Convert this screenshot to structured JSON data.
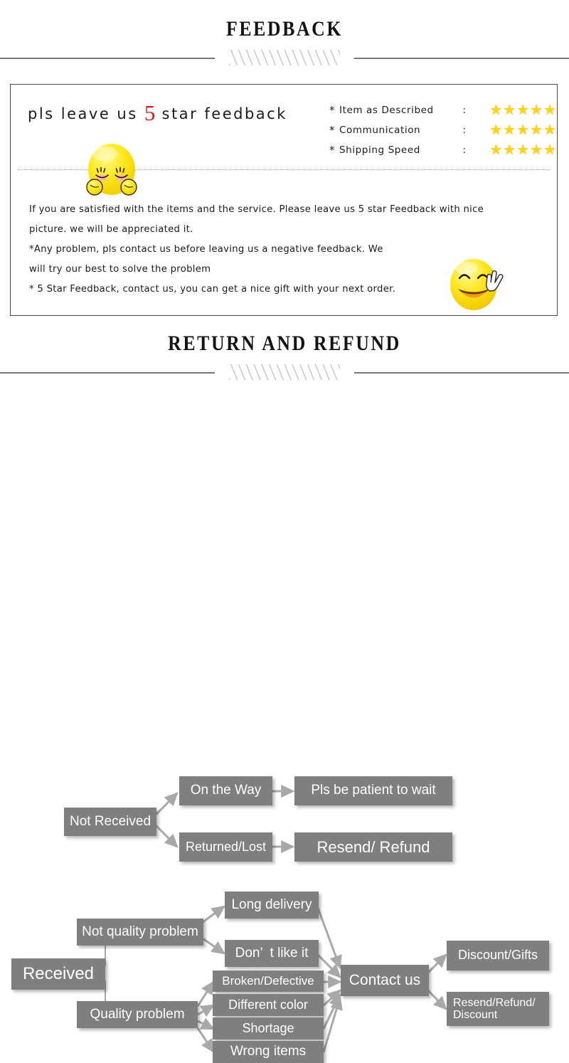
{
  "sections": {
    "feedback_heading": "FEEDBACK",
    "return_heading": "RETURN AND REFUND"
  },
  "feedback": {
    "headline_pre": "pls leave us ",
    "headline_five": "5",
    "headline_post": " star feedback",
    "ratings": [
      {
        "asterisk": "*",
        "label": "Item as Described",
        "colon": ":",
        "stars": "★★★★★",
        "value": 5
      },
      {
        "asterisk": "*",
        "label": "Communication",
        "colon": ":",
        "stars": "★★★★★",
        "value": 5
      },
      {
        "asterisk": "*",
        "label": "Shipping Speed",
        "colon": ":",
        "stars": "★★★★★",
        "value": 5
      }
    ],
    "star_color": "#ffd21e",
    "five_color": "#d21b1b",
    "body_lines": [
      "If you are satisfied with the items and the service. Please leave us 5 star Feedback with nice",
      "picture. we will be appreciated it.",
      "*Any problem, pls contact us before leaving us a negative feedback. We",
      "will try our best to solve  the problem",
      "* 5 Star Feedback, contact us, you can get a nice gift with your next order."
    ],
    "emoji_shy_name": "shy-blushing-face-emoji",
    "emoji_happy_name": "smiling-face-with-peace-sign-emoji"
  },
  "flowchart": {
    "box_color": "#7f7f7f",
    "text_color": "#ffffff",
    "nodes": {
      "not_received": "Not Received",
      "on_the_way": "On the Way",
      "pls_be_patient": "Pls be patient to wait",
      "returned_lost": "Returned/Lost",
      "resend_refund": "Resend/ Refund",
      "received": "Received",
      "not_quality_problem": "Not quality problem",
      "quality_problem": "Quality problem",
      "long_delivery": "Long delivery",
      "dont_like_it": "Don’  t like it",
      "broken_defective": "Broken/Defective",
      "different_color": "Different color",
      "shortage": "Shortage",
      "wrong_items": "Wrong items",
      "contact_us": "Contact us",
      "discount_gifts": "Discount/Gifts",
      "resend_refund_discount": "Resend/Refund/\nDiscount"
    }
  }
}
